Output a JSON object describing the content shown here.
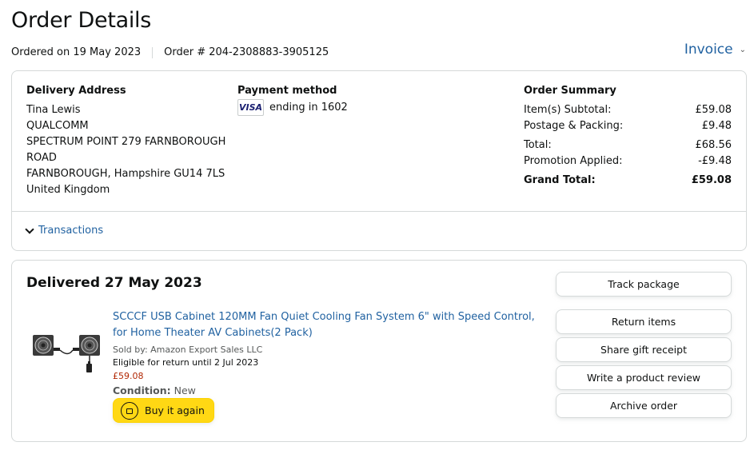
{
  "page": {
    "title": "Order Details",
    "ordered_on": "Ordered on 19 May 2023",
    "order_number": "Order # 204-2308883-3905125",
    "invoice_label": "Invoice"
  },
  "delivery": {
    "heading": "Delivery Address",
    "lines": [
      "Tina Lewis",
      "QUALCOMM",
      "SPECTRUM POINT 279 FARNBOROUGH",
      "ROAD",
      "FARNBOROUGH, Hampshire GU14 7LS",
      "United Kingdom"
    ]
  },
  "payment": {
    "heading": "Payment method",
    "card_brand": "VISA",
    "card_text": "ending in 1602"
  },
  "summary": {
    "heading": "Order Summary",
    "rows": [
      {
        "label": "Item(s) Subtotal:",
        "value": "£59.08"
      },
      {
        "label": "Postage & Packing:",
        "value": "£9.48"
      },
      {
        "label": "Total:",
        "value": "£68.56"
      },
      {
        "label": "Promotion Applied:",
        "value": "-£9.48"
      },
      {
        "label": "Grand Total:",
        "value": "£59.08"
      }
    ]
  },
  "transactions_label": "Transactions",
  "shipment": {
    "status": "Delivered 27 May 2023",
    "product": {
      "title": "SCCCF USB Cabinet 120MM Fan Quiet Cooling Fan System 6\" with Speed Control, for Home Theater AV Cabinets(2 Pack)",
      "sold_by": "Sold by: Amazon Export Sales LLC",
      "return_eligibility": "Eligible for return until 2 Jul 2023",
      "price": "£59.08",
      "condition_label": "Condition:",
      "condition_value": "New",
      "buy_again_label": "Buy it again",
      "image_icon": "fan-product-image"
    },
    "buttons": {
      "track": "Track package",
      "return": "Return items",
      "gift": "Share gift receipt",
      "review": "Write a product review",
      "archive": "Archive order"
    }
  },
  "colors": {
    "link": "#2162a1",
    "price": "#b12704",
    "buy_again": "#ffd814",
    "border": "#d5d9d9"
  }
}
